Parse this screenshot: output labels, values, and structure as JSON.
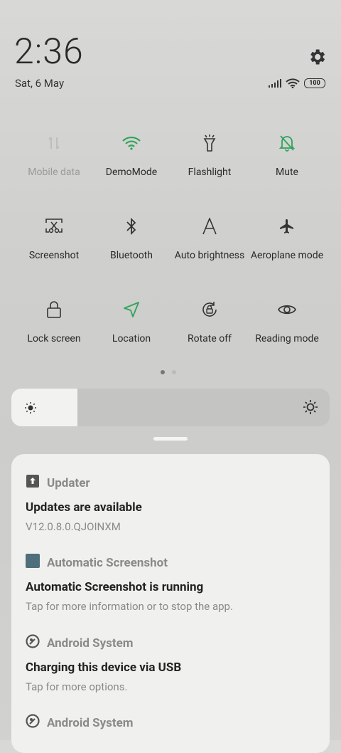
{
  "status": {
    "time": "2:36",
    "date": "Sat, 6 May",
    "battery": "100"
  },
  "tiles": [
    {
      "label": "Mobile data",
      "icon": "mobile-data-icon",
      "active": false
    },
    {
      "label": "DemoMode",
      "icon": "wifi-icon",
      "active": true
    },
    {
      "label": "Flashlight",
      "icon": "flashlight-icon",
      "active": false
    },
    {
      "label": "Mute",
      "icon": "mute-bell-icon",
      "active": true
    },
    {
      "label": "Screenshot",
      "icon": "screenshot-icon",
      "active": false
    },
    {
      "label": "Bluetooth",
      "icon": "bluetooth-icon",
      "active": false
    },
    {
      "label": "Auto brightness",
      "icon": "auto-brightness-icon",
      "active": false
    },
    {
      "label": "Aeroplane mode",
      "icon": "airplane-icon",
      "active": false
    },
    {
      "label": "Lock screen",
      "icon": "lock-icon",
      "active": false
    },
    {
      "label": "Location",
      "icon": "location-icon",
      "active": true
    },
    {
      "label": "Rotate off",
      "icon": "rotate-lock-icon",
      "active": false
    },
    {
      "label": "Reading mode",
      "icon": "eye-icon",
      "active": false
    }
  ],
  "notifications": [
    {
      "app": "Updater",
      "title": "Updates are available",
      "text": "V12.0.8.0.QJOINXM"
    },
    {
      "app": "Automatic Screenshot",
      "title": "Automatic Screenshot is running",
      "text": "Tap for more information or to stop the app."
    },
    {
      "app": "Android System",
      "title": "Charging this device via USB",
      "text": "Tap for more options."
    },
    {
      "app": "Android System",
      "title": "",
      "text": ""
    }
  ],
  "colors": {
    "accent_green": "#2fa35a",
    "text": "#2a2a2a",
    "muted": "#8a8a8a"
  }
}
